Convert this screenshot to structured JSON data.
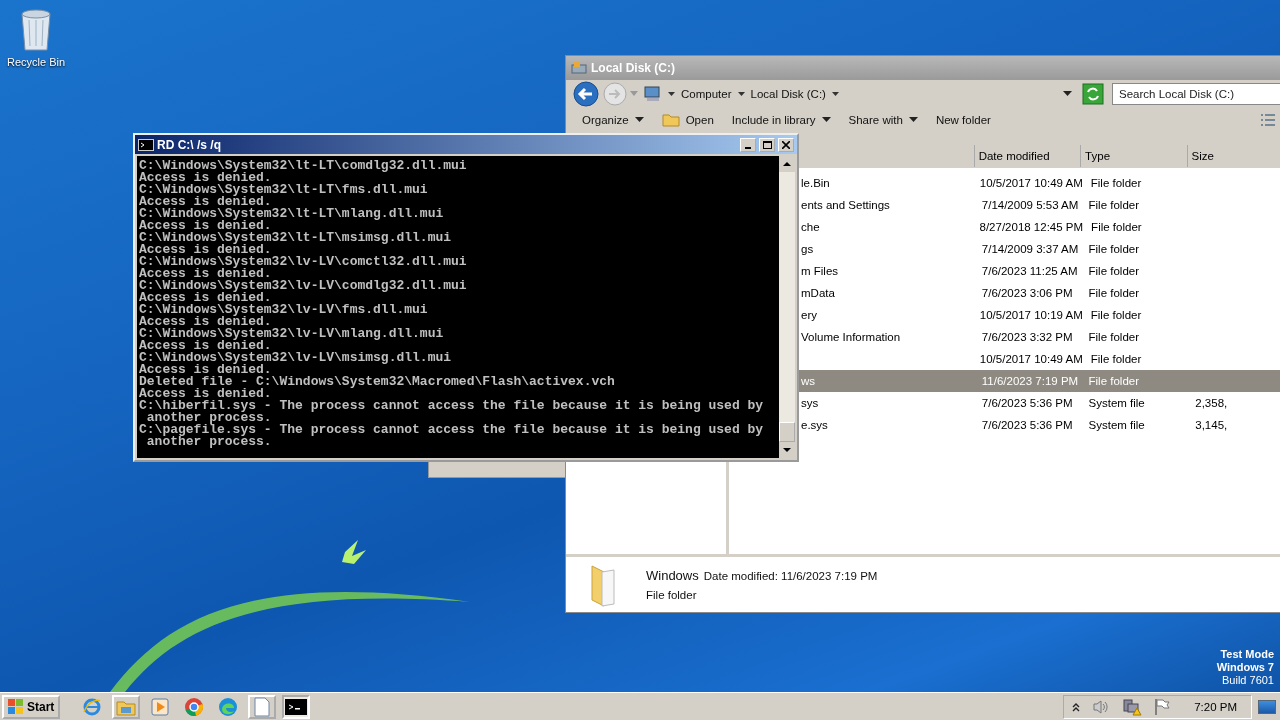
{
  "desktop": {
    "icons": [
      {
        "label": "Recycle Bin"
      }
    ],
    "notice": [
      "Test Mode",
      "Windows 7",
      "Build 7601"
    ]
  },
  "explorer": {
    "title": "Local Disk (C:)",
    "breadcrumb": [
      "Computer",
      "Local Disk (C:)"
    ],
    "search": {
      "placeholder": "Search Local Disk (C:)"
    },
    "toolbar": [
      {
        "label": "Organize",
        "kind": "menu"
      },
      {
        "label": "Open",
        "kind": "open"
      },
      {
        "label": "Include in library",
        "kind": "menu"
      },
      {
        "label": "Share with",
        "kind": "menu"
      },
      {
        "label": "New folder",
        "kind": "button"
      }
    ],
    "columns": [
      "Date modified",
      "Type",
      "Size"
    ],
    "rows": [
      {
        "name": "le.Bin",
        "date": "10/5/2017 10:49 AM",
        "type": "File folder",
        "selected": false
      },
      {
        "name": "ents and Settings",
        "date": "7/14/2009 5:53 AM",
        "type": "File folder",
        "selected": false
      },
      {
        "name": "che",
        "date": "8/27/2018 12:45 PM",
        "type": "File folder",
        "selected": false
      },
      {
        "name": "gs",
        "date": "7/14/2009 3:37 AM",
        "type": "File folder",
        "selected": false
      },
      {
        "name": "m Files",
        "date": "7/6/2023 11:25 AM",
        "type": "File folder",
        "selected": false
      },
      {
        "name": "mData",
        "date": "7/6/2023 3:06 PM",
        "type": "File folder",
        "selected": false
      },
      {
        "name": "ery",
        "date": "10/5/2017 10:19 AM",
        "type": "File folder",
        "selected": false
      },
      {
        "name": "Volume Information",
        "date": "7/6/2023 3:32 PM",
        "type": "File folder",
        "selected": false
      },
      {
        "date": "10/5/2017 10:49 AM",
        "type": "File folder",
        "selected": false
      },
      {
        "name": "ws",
        "date": "11/6/2023 7:19 PM",
        "type": "File folder",
        "selected": true
      },
      {
        "name": "sys",
        "date": "7/6/2023 5:36 PM",
        "type": "System file",
        "size": "2,358,",
        "selected": false
      },
      {
        "name": "e.sys",
        "date": "7/6/2023 5:36 PM",
        "type": "System file",
        "size": "3,145,",
        "selected": false
      }
    ],
    "details": {
      "name": "Windows",
      "modified": "Date modified: 11/6/2023 7:19 PM",
      "type": "File folder"
    }
  },
  "console": {
    "title": "RD C:\\ /s /q",
    "lines": [
      "C:\\Windows\\System32\\lt-LT\\comdlg32.dll.mui",
      "Access is denied.",
      "C:\\Windows\\System32\\lt-LT\\fms.dll.mui",
      "Access is denied.",
      "C:\\Windows\\System32\\lt-LT\\mlang.dll.mui",
      "Access is denied.",
      "C:\\Windows\\System32\\lt-LT\\msimsg.dll.mui",
      "Access is denied.",
      "C:\\Windows\\System32\\lv-LV\\comctl32.dll.mui",
      "Access is denied.",
      "C:\\Windows\\System32\\lv-LV\\comdlg32.dll.mui",
      "Access is denied.",
      "C:\\Windows\\System32\\lv-LV\\fms.dll.mui",
      "Access is denied.",
      "C:\\Windows\\System32\\lv-LV\\mlang.dll.mui",
      "Access is denied.",
      "C:\\Windows\\System32\\lv-LV\\msimsg.dll.mui",
      "Access is denied.",
      "Deleted file - C:\\Windows\\System32\\Macromed\\Flash\\activex.vch",
      "Access is denied.",
      "C:\\hiberfil.sys - The process cannot access the file because it is being used by",
      " another process.",
      "C:\\pagefile.sys - The process cannot access the file because it is being used by",
      " another process."
    ]
  },
  "taskbar": {
    "start": "Start",
    "apps": [
      {
        "kind": "browser",
        "running": false,
        "selected": false
      },
      {
        "kind": "folder",
        "running": true,
        "selected": false
      },
      {
        "kind": "player",
        "running": false,
        "selected": false
      },
      {
        "kind": "chrome",
        "running": false,
        "selected": false
      },
      {
        "kind": "edge",
        "running": false,
        "selected": false
      },
      {
        "kind": "notepad",
        "running": true,
        "selected": false
      },
      {
        "kind": "console",
        "running": true,
        "selected": true
      }
    ],
    "clock": "7:20 PM"
  }
}
